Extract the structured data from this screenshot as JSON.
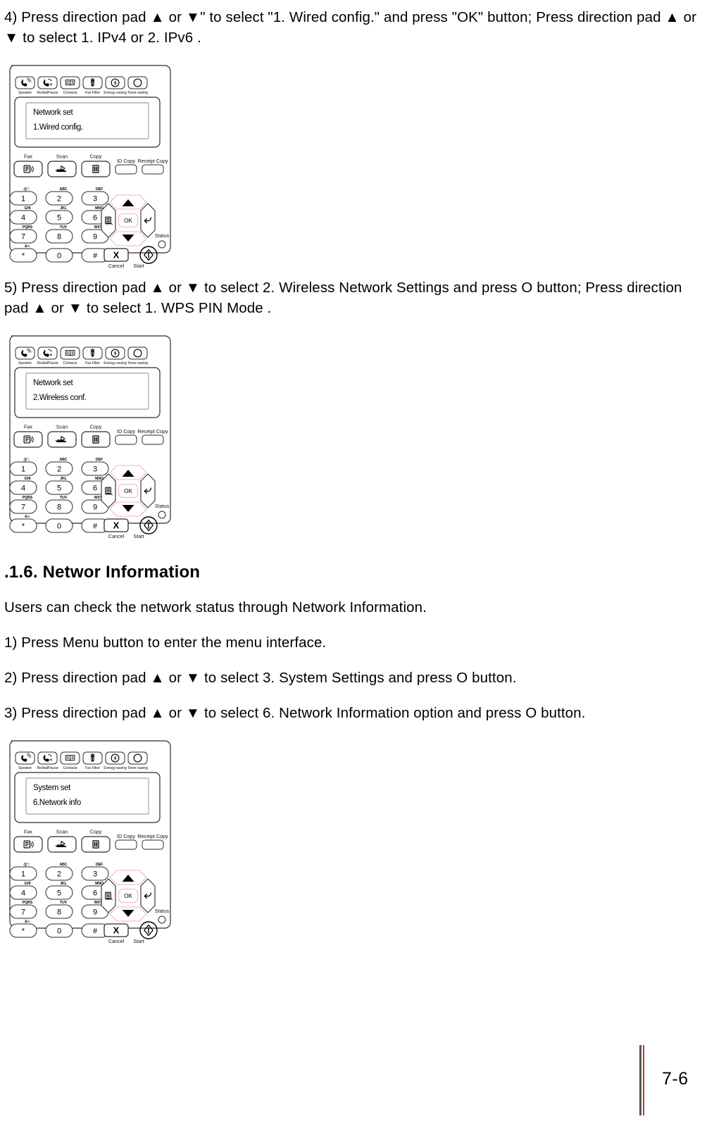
{
  "document": {
    "page_number": "7-6"
  },
  "steps": {
    "step4": "4) Press direction pad  ▲  or  ▼\" to select \"1. Wired config.\" and press \"OK\" button; Press direction pad  ▲  or  ▼  to select  1. IPv4  or  2. IPv6 .",
    "step5": "5) Press direction pad  ▲  or  ▼  to select  2. Wireless Network Settings  and press  O button; Press direction pad  ▲  or  ▼  to select  1. WPS PIN Mode .",
    "section_heading": ".1.6. Networ   Information",
    "intro": "Users can check the network status through Network Information.",
    "step1": "1) Press  Menu  button to enter the menu interface.",
    "step2": "2) Press direction pad  ▲  or  ▼  to select  3. System Settings  and press  O    button.",
    "step3": "3) Press direction pad  ▲  or  ▼  to select  6. Network Information  option and press  O button."
  },
  "panels": [
    {
      "id": "panel-wired-config",
      "lcd_line1": "Network set",
      "lcd_line2": "1.Wired config."
    },
    {
      "id": "panel-wireless-config",
      "lcd_line1": "Network set",
      "lcd_line2": "2.Wireless conf."
    },
    {
      "id": "panel-network-info",
      "lcd_line1": "System set",
      "lcd_line2": "6.Network info"
    }
  ],
  "control_panel": {
    "top_buttons": [
      {
        "icon": "speaker-icon",
        "label": "Speaker"
      },
      {
        "icon": "redial-pause-icon",
        "label": "Redial/Pause"
      },
      {
        "icon": "contacts-icon",
        "label": "Contacts"
      },
      {
        "icon": "fax-filter-icon",
        "label": "Fax Filter"
      },
      {
        "icon": "energy-saving-icon",
        "label": "Energy-saving"
      },
      {
        "icon": "toner-saving-icon",
        "label": "Toner-saving"
      }
    ],
    "mode_buttons": [
      {
        "icon": "fax-icon",
        "label": "Fax"
      },
      {
        "icon": "scan-icon",
        "label": "Scan"
      },
      {
        "icon": "copy-icon",
        "label": "Copy"
      }
    ],
    "extra_buttons": [
      {
        "label": "ID Copy"
      },
      {
        "label": "Receipt Copy"
      }
    ],
    "keypad": [
      {
        "num": "1",
        "alpha": "@'："
      },
      {
        "num": "2",
        "alpha": "ABC"
      },
      {
        "num": "3",
        "alpha": "DEF"
      },
      {
        "num": "4",
        "alpha": "GHI"
      },
      {
        "num": "5",
        "alpha": "JKL"
      },
      {
        "num": "6",
        "alpha": "MNO"
      },
      {
        "num": "7",
        "alpha": "PQRS"
      },
      {
        "num": "8",
        "alpha": "TUV"
      },
      {
        "num": "9",
        "alpha": "WXYZ"
      },
      {
        "num": "*",
        "alpha": "&+."
      },
      {
        "num": "0",
        "alpha": ""
      },
      {
        "num": "#",
        "alpha": ""
      }
    ],
    "nav": {
      "ok_label": "OK",
      "up_icon": "up-arrow-icon",
      "down_icon": "down-arrow-icon",
      "menu_icon": "menu-icon",
      "back_icon": "back-arrow-icon"
    },
    "status_label": "Status",
    "cancel_label": "Cancel",
    "start_label": "Start",
    "cancel_glyph": "X",
    "accent_color": "#f4b3b3"
  }
}
